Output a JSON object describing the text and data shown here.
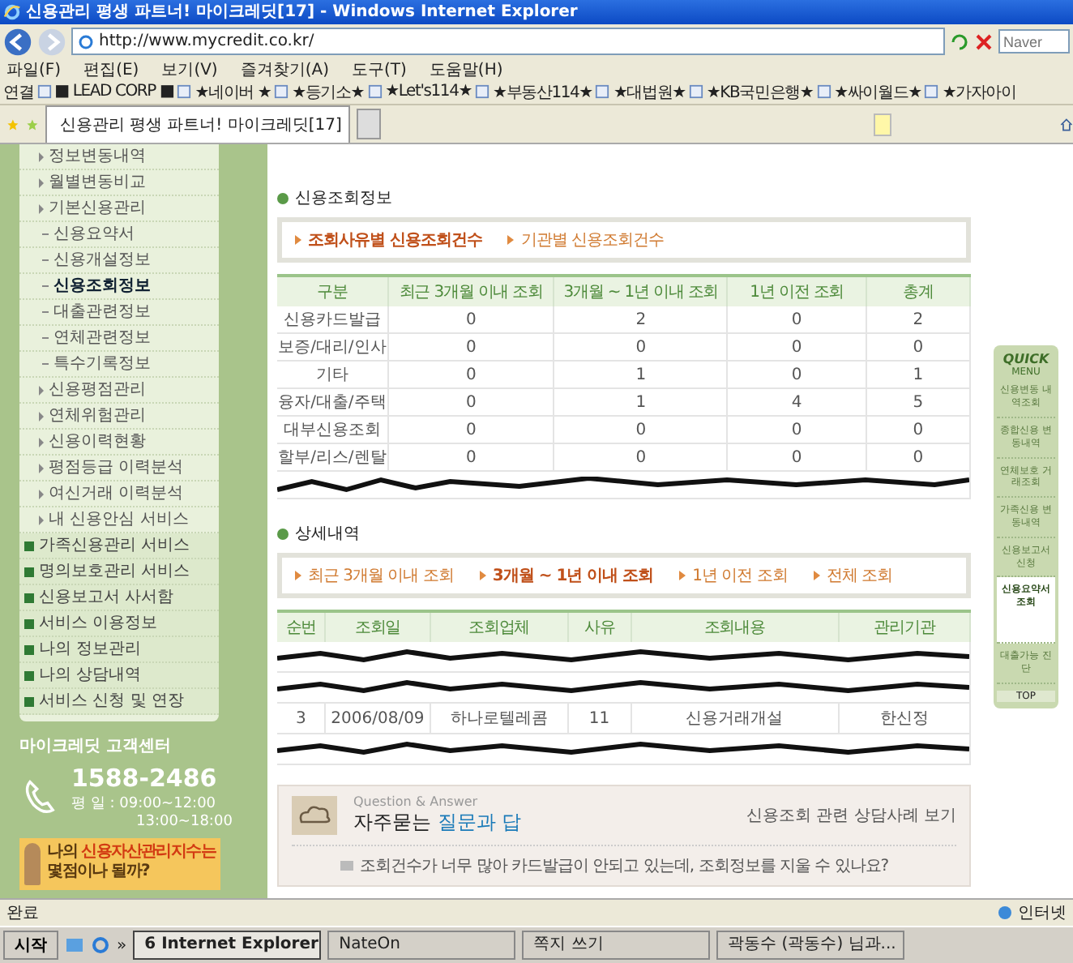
{
  "window": {
    "title": "신용관리 평생 파트너! 마이크레딧[17] - Windows Internet Explorer"
  },
  "address_bar": {
    "url": "http://www.mycredit.co.kr/",
    "search_placeholder": "Naver"
  },
  "menu_bar": [
    "파일(F)",
    "편집(E)",
    "보기(V)",
    "즐겨찾기(A)",
    "도구(T)",
    "도움말(H)"
  ],
  "links_bar": {
    "label": "연결",
    "links": [
      "■ LEAD CORP ■",
      "★네이버 ★",
      "★등기소★",
      "★Let's114★",
      "★부동산114★",
      "★대법원★",
      "★KB국민은행★",
      "★싸이월드★",
      "★가자아이"
    ]
  },
  "tab": {
    "title": "신용관리 평생 파트너! 마이크레딧[17]"
  },
  "sidebar": {
    "items": [
      {
        "label": "정보변동내역",
        "kind": "arrow",
        "selected": false
      },
      {
        "label": "월별변동비교",
        "kind": "arrow",
        "selected": false
      },
      {
        "label": "기본신용관리",
        "kind": "arrow",
        "selected": false
      },
      {
        "label": "신용요약서",
        "kind": "dash",
        "selected": false
      },
      {
        "label": "신용개설정보",
        "kind": "dash",
        "selected": false
      },
      {
        "label": "신용조회정보",
        "kind": "dash",
        "selected": true
      },
      {
        "label": "대출관련정보",
        "kind": "dash",
        "selected": false
      },
      {
        "label": "연체관련정보",
        "kind": "dash",
        "selected": false
      },
      {
        "label": "특수기록정보",
        "kind": "dash",
        "selected": false
      },
      {
        "label": "신용평점관리",
        "kind": "arrow",
        "selected": false
      },
      {
        "label": "연체위험관리",
        "kind": "arrow",
        "selected": false
      },
      {
        "label": "신용이력현황",
        "kind": "arrow",
        "selected": false
      },
      {
        "label": "평점등급 이력분석",
        "kind": "arrow",
        "selected": false
      },
      {
        "label": "여신거래 이력분석",
        "kind": "arrow",
        "selected": false
      },
      {
        "label": "내 신용안심 서비스",
        "kind": "arrow",
        "selected": false
      },
      {
        "label": "가족신용관리 서비스",
        "kind": "square",
        "selected": false
      },
      {
        "label": "명의보호관리 서비스",
        "kind": "square",
        "selected": false
      },
      {
        "label": "신용보고서 사서함",
        "kind": "square",
        "selected": false
      },
      {
        "label": "서비스 이용정보",
        "kind": "square",
        "selected": false
      },
      {
        "label": "나의 정보관리",
        "kind": "square",
        "selected": false
      },
      {
        "label": "나의 상담내역",
        "kind": "square",
        "selected": false
      },
      {
        "label": "서비스 신청 및 연장",
        "kind": "square",
        "selected": false
      }
    ],
    "customer_center": {
      "title": "마이크레딧 고객센터",
      "phone": "1588-2486",
      "hours": "평 일 : 09:00~12:00",
      "hours_2": "13:00~18:00"
    },
    "banner": {
      "lead": "나의",
      "highlight": "신용자산관리지수는",
      "tail": "몇점이나 될까?"
    }
  },
  "inquiry_info": {
    "heading": "신용조회정보",
    "tabs": [
      {
        "label": "조회사유별 신용조회건수",
        "selected": true
      },
      {
        "label": "기관별 신용조회건수",
        "selected": false
      }
    ],
    "table": {
      "columns": [
        "구분",
        "최근 3개월 이내 조회",
        "3개월 ~ 1년 이내 조회",
        "1년 이전 조회",
        "총계"
      ],
      "rows": [
        {
          "redacted": false,
          "cells": [
            "신용카드발급",
            "0",
            "2",
            "0",
            "2"
          ]
        },
        {
          "redacted": false,
          "cells": [
            "보증/대리/인사",
            "0",
            "0",
            "0",
            "0"
          ]
        },
        {
          "redacted": false,
          "cells": [
            "기타",
            "0",
            "1",
            "0",
            "1"
          ]
        },
        {
          "redacted": false,
          "cells": [
            "융자/대출/주택",
            "0",
            "1",
            "4",
            "5"
          ]
        },
        {
          "redacted": false,
          "cells": [
            "대부신용조회",
            "0",
            "0",
            "0",
            "0"
          ]
        },
        {
          "redacted": false,
          "cells": [
            "할부/리스/렌탈",
            "0",
            "0",
            "0",
            "0"
          ]
        },
        {
          "redacted": true
        }
      ]
    }
  },
  "details": {
    "heading": "상세내역",
    "tabs": [
      {
        "label": "최근 3개월 이내 조회",
        "selected": false
      },
      {
        "label": "3개월 ~ 1년 이내 조회",
        "selected": true
      },
      {
        "label": "1년 이전 조회",
        "selected": false
      },
      {
        "label": "전체 조회",
        "selected": false
      }
    ],
    "table": {
      "columns": [
        "순번",
        "조회일",
        "조회업체",
        "사유",
        "조회내용",
        "관리기관"
      ],
      "rows": [
        {
          "redacted": true
        },
        {
          "redacted": true
        },
        {
          "redacted": false,
          "cells": [
            "3",
            "2006/08/09",
            "하나로텔레콤",
            "11",
            "신용거래개설",
            "한신정"
          ]
        },
        {
          "redacted": true
        }
      ]
    }
  },
  "qa": {
    "eyebrow": "Question & Answer",
    "title_lead": "자주묻는",
    "title_highlight": "질문과 답",
    "link": "신용조회 관련 상담사례 보기",
    "questions": [
      "조회건수가 너무 많아 카드발급이 안되고 있는데, 조회정보를 지울 수 있나요?"
    ]
  },
  "quick_menu": {
    "title": "QUICK",
    "subtitle": "MENU",
    "items": [
      {
        "label": "신용변동 내역조회",
        "selected": false
      },
      {
        "label": "종합신용 변동내역",
        "selected": false
      },
      {
        "label": "연체보호 거래조회",
        "selected": false
      },
      {
        "label": "가족신용 변동내역",
        "selected": false
      },
      {
        "label": "신용보고서 신청",
        "selected": false
      },
      {
        "label": "신용요약서 조회",
        "selected": true
      },
      {
        "label": "대출가능 진단",
        "selected": false
      }
    ],
    "top": "TOP"
  },
  "status_bar": {
    "text": "완료",
    "zone": "인터넷"
  },
  "taskbar": {
    "start": "시작",
    "more": "»",
    "tasks": [
      {
        "label": "6 Internet Explorer",
        "selected": true
      },
      {
        "label": "NateOn",
        "selected": false
      },
      {
        "label": "쪽지 쓰기",
        "selected": false
      },
      {
        "label": "곽동수 (곽동수) 님과...",
        "selected": false
      }
    ]
  }
}
